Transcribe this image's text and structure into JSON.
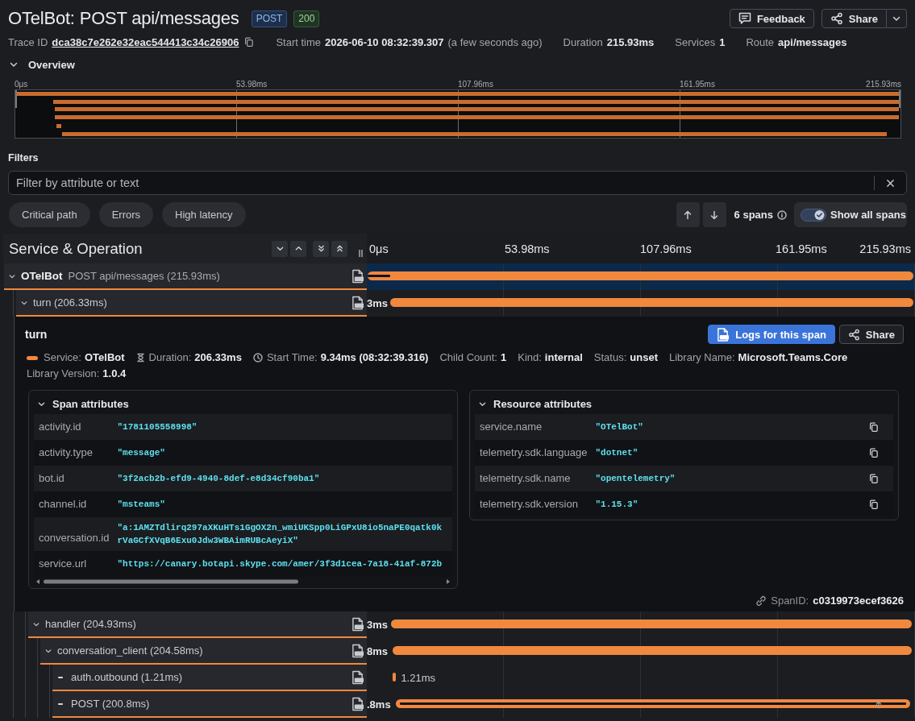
{
  "header": {
    "title": "OTelBot: POST api/messages",
    "badges": [
      {
        "text": "POST",
        "kind": "method"
      },
      {
        "text": "200",
        "kind": "status"
      }
    ],
    "actions": [
      {
        "label": "Feedback",
        "kind": "feedback",
        "menu": false
      },
      {
        "label": "Share",
        "kind": "share",
        "menu": true
      }
    ]
  },
  "trace_info": [
    {
      "label": "Trace ID",
      "value": "dca38c7e262e32eac544413c34c26906",
      "kind": "link"
    },
    {
      "label": "Start time",
      "value": "2026-06-10 08:32:39.307",
      "note": "(a few seconds ago)",
      "kind": "text"
    },
    {
      "label": "Duration",
      "value": "215.93ms",
      "kind": "text"
    },
    {
      "label": "Services",
      "value": "1",
      "kind": "text"
    },
    {
      "label": "Route",
      "value": "api/messages",
      "kind": "text"
    }
  ],
  "overview": {
    "title": "Overview",
    "expanded": true,
    "ticks": [
      "0μs",
      "53.98ms",
      "107.96ms",
      "161.95ms",
      "215.93ms"
    ]
  },
  "filters": {
    "title": "Filters",
    "search": {
      "placeholder": "Filter by attribute or text"
    },
    "chips": [
      {
        "label": "Critical path",
        "selected": false
      },
      {
        "label": "Errors",
        "selected": false
      },
      {
        "label": "High latency",
        "selected": false
      }
    ],
    "span_count": "6 spans",
    "show_all": {
      "label": "Show all spans",
      "on": true
    }
  },
  "trace": {
    "column_title": "Service & Operation",
    "ticks": [
      "0μs",
      "53.98ms",
      "107.96ms",
      "161.95ms",
      "215.93ms"
    ],
    "spans": [
      {
        "service": "OTelBot",
        "operation": "POST api/messages (215.93ms)",
        "selected": true,
        "expanded": true,
        "children": [
          {
            "operation": "turn (206.33ms)",
            "selected": false,
            "expanded": true,
            "timeline_label": "3ms",
            "kind": "clipped",
            "details": {
              "title": "turn",
              "actions": [
                {
                  "label": "Logs for this span",
                  "kind": "logs"
                },
                {
                  "label": "Share",
                  "kind": "share"
                }
              ],
              "fields": [
                {
                  "label": "Service:",
                  "value": "OTelBot",
                  "kind": "service"
                },
                {
                  "label": "Duration:",
                  "value": "206.33ms",
                  "kind": "duration"
                },
                {
                  "label": "Start Time:",
                  "value": "9.34ms (08:32:39.316)",
                  "kind": "start"
                },
                {
                  "label": "Child Count:",
                  "value": "1",
                  "kind": "plain"
                },
                {
                  "label": "Kind:",
                  "value": "internal",
                  "kind": "plain"
                },
                {
                  "label": "Status:",
                  "value": "unset",
                  "kind": "plain"
                },
                {
                  "label": "Library Name:",
                  "value": "Microsoft.Teams.Core",
                  "kind": "plain"
                },
                {
                  "label": "Library Version:",
                  "value": "1.0.4",
                  "kind": "plain"
                }
              ],
              "attribute_groups": [
                {
                  "title": "Span attributes",
                  "expanded": true,
                  "copy_buttons": false,
                  "scrollbar": true,
                  "rows": [
                    {
                      "key": "activity.id",
                      "value": "\"1781105558998\""
                    },
                    {
                      "key": "activity.type",
                      "value": "\"message\""
                    },
                    {
                      "key": "bot.id",
                      "value": "\"3f2acb2b-efd9-4940-8def-e8d34cf90ba1\""
                    },
                    {
                      "key": "channel.id",
                      "value": "\"msteams\""
                    },
                    {
                      "key": "conversation.id",
                      "value": "\"a:1AMZTdlirq297aXKuHTs1GgOX2n_wmiUKSpp0LiGPxU8io5naPE0qatk0krVaGCfXVqB6Exu0Jdw3WBAimRUBcAeyiX\""
                    },
                    {
                      "key": "service.url",
                      "value": "\"https://canary.botapi.skype.com/amer/3f3d1cea-7a18-41af-872b"
                    }
                  ]
                },
                {
                  "title": "Resource attributes",
                  "expanded": true,
                  "copy_buttons": true,
                  "scrollbar": false,
                  "rows": [
                    {
                      "key": "service.name",
                      "value": "\"OTelBot\""
                    },
                    {
                      "key": "telemetry.sdk.language",
                      "value": "\"dotnet\""
                    },
                    {
                      "key": "telemetry.sdk.name",
                      "value": "\"opentelemetry\""
                    },
                    {
                      "key": "telemetry.sdk.version",
                      "value": "\"1.15.3\""
                    }
                  ]
                }
              ],
              "span_id": {
                "label": "SpanID:",
                "value": "c0319973ecef3626"
              }
            },
            "children": [
              {
                "operation": "handler (204.93ms)",
                "selected": false,
                "expanded": true,
                "timeline_label": "3ms",
                "kind": "clipped",
                "children": [
                  {
                    "operation": "conversation_client (204.58ms)",
                    "selected": false,
                    "expanded": true,
                    "timeline_label": "8ms",
                    "kind": "clipped",
                    "children": [
                      {
                        "operation": "auth.outbound (1.21ms)",
                        "selected": false,
                        "timeline_label": "1.21ms",
                        "kind": "trailing"
                      },
                      {
                        "operation": "POST (200.8ms)",
                        "selected": false,
                        "timeline_label": ".8ms",
                        "kind": "clipped"
                      }
                    ]
                  }
                ]
              }
            ]
          }
        ]
      }
    ]
  }
}
